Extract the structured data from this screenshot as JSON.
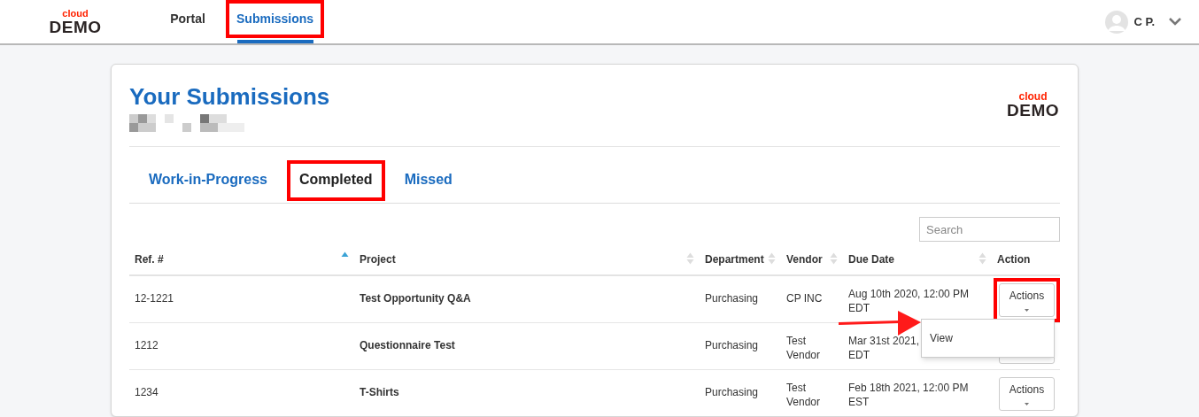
{
  "header": {
    "logo": {
      "top": "cloud",
      "bottom": "DEMO"
    },
    "nav": [
      {
        "label": "Portal",
        "selected": false,
        "highlighted": false
      },
      {
        "label": "Submissions",
        "selected": true,
        "highlighted": true
      }
    ],
    "user": {
      "name": "C P."
    }
  },
  "page": {
    "title": "Your Submissions",
    "logo": {
      "top": "cloud",
      "bottom": "DEMO"
    }
  },
  "tabs": [
    {
      "label": "Work-in-Progress",
      "selected": false,
      "highlighted": false
    },
    {
      "label": "Completed",
      "selected": true,
      "highlighted": true
    },
    {
      "label": "Missed",
      "selected": false,
      "highlighted": false
    }
  ],
  "search": {
    "placeholder": "Search"
  },
  "table": {
    "columns": [
      {
        "label": "Ref. #",
        "sorted": true
      },
      {
        "label": "Project",
        "sorted": false
      },
      {
        "label": "Department",
        "sorted": false
      },
      {
        "label": "Vendor",
        "sorted": false
      },
      {
        "label": "Due Date",
        "sorted": false
      },
      {
        "label": "Action"
      }
    ],
    "rows": [
      {
        "ref": "12-1221",
        "project": "Test Opportunity Q&A",
        "department": "Purchasing",
        "vendor": "CP INC",
        "due_date": "Aug 10th 2020, 12:00 PM EDT",
        "action": "Actions",
        "highlighted": true,
        "menu_open": true,
        "menu_items": [
          "View"
        ]
      },
      {
        "ref": "1212",
        "project": "Questionnaire Test",
        "department": "Purchasing",
        "vendor": "Test Vendor",
        "due_date": "Mar 31st 2021,\nEDT",
        "highlighted": false,
        "menu_open": false
      },
      {
        "ref": "1234",
        "project": "T-Shirts",
        "department": "Purchasing",
        "vendor": "Test Vendor",
        "due_date": "Feb 18th 2021, 12:00 PM EST",
        "action": "Actions",
        "highlighted": false,
        "menu_open": false
      }
    ]
  },
  "arrow": true
}
